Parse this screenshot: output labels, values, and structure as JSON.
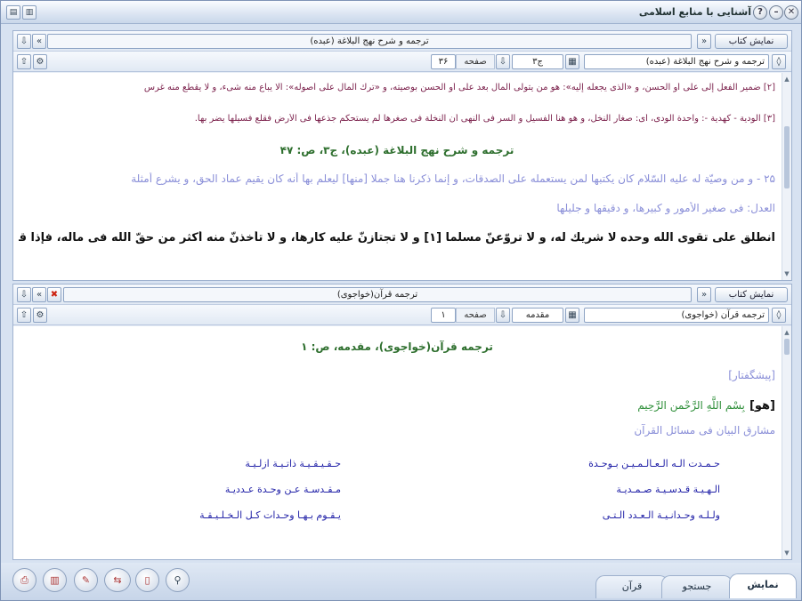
{
  "window": {
    "title": "آشنایی با منابع اسلامی",
    "icons": [
      "close-icon",
      "minimize-icon",
      "help-icon"
    ]
  },
  "pane1": {
    "show_book_label": "نمایش کتاب",
    "book_title": "ترجمه و شرح نهج البلاغة (عبده)",
    "book_select": "ترجمه و شرح نهج البلاغة (عبده)",
    "volume_value": "ج۳",
    "page_label": "صفحه",
    "page_value": "۳۶",
    "lines": {
      "fn1": "[۲] ضمیر الفعل إلى على أو الحسن، و «الّذى يجعله إليه»: هو من يتولى المال بعد على أو الحسن بوصيته، و «ترك المال على أصوله»: ألا يباع منه شىء، و لا يقطع منه غرس",
      "fn2": "[۳] الودية - كهدية -: واحدة الودى، أى: صغار النخل، و هو هنا الفسيل و السر فى النهى أن النخلة فى صغرها لم يستحكم جذعها فى الأرض فقلع فسيلها يضر بها.",
      "heading": "ترجمه و شرح نهج البلاغة (عبده)، ج۳، ص: ۴۷",
      "p1": "۲۵ - و من وصيّة له عليه السّلام كان يكتبها لمن يستعمله على الصدقات، و إنما ذكرنا هنا جملا [منها] ليعلم بها أنه كان يقيم عماد الحق، و يشرع أمثلة",
      "p2": "العدل: فى صغير الأمور و كبيرها، و دقيقها و جليلها",
      "p3": "انطلق على تقوى اللّه وحده لا شريك له، و لا تروّعنّ مسلما [۱] و لا تجتازنّ عليه كارها، و لا تأخذنّ منه أكثر من حقّ اللّه فى ماله، فإذا قدمت على"
    }
  },
  "pane2": {
    "show_book_label": "نمایش کتاب",
    "book_title": "ترجمه قرآن(خواجوى)",
    "book_select": "ترجمه قرآن (خواجوى)",
    "volume_value": "مقدمه",
    "page_label": "صفحه",
    "page_value": "۱",
    "lines": {
      "heading": "ترجمه قرآن(خواجوى)، مقدمه، ص: ۱",
      "preface": "[پيشگفتار]",
      "basmala_prefix": "[هو]",
      "basmala": "بِسْمِ اللَّهِ الرَّحْمنِ الرَّحِيمِ",
      "subtitle": "مشارق البيان فى مسائل القرآن",
      "poem": [
        {
          "right": "حـمـدت الـه الـعـالـمـيـن بـوحـدة",
          "left": "حـقـيـقـيـة ذاتـيـة ازلـيـة"
        },
        {
          "right": "الـهـيـة قـدسـيـة صـمـديـة",
          "left": "مـقـدسـة عـن وحـدة عـدديـة"
        },
        {
          "right": "ولـلـه وحـدانـيـة الـعـدد الـتـى",
          "left": "يـقـوم بـهـا وحـدات كـل الـخـلـيـقـة"
        }
      ]
    }
  },
  "bottom": {
    "tabs": [
      "نمایش",
      "جستجو",
      "قرآن"
    ],
    "round_buttons": [
      "print-icon",
      "books-icon",
      "edit-icon",
      "compare-icon",
      "note-icon",
      "search-icon"
    ]
  },
  "colors": {
    "accent_green": "#2e6f2e",
    "footnote": "#7a1f4a",
    "lavender": "#8a8fd8",
    "poem_blue": "#2323a8"
  }
}
